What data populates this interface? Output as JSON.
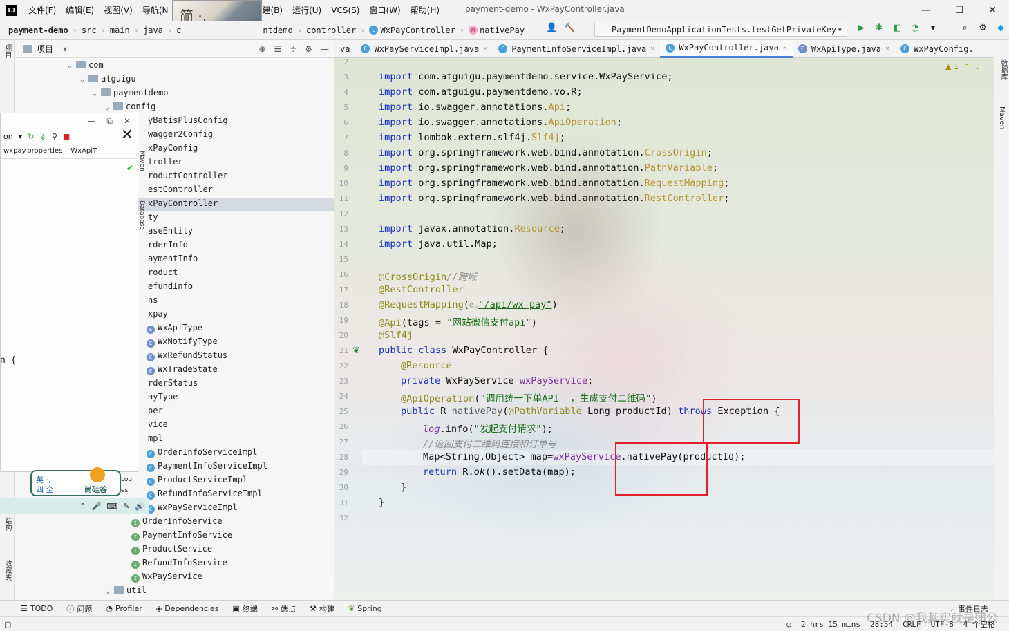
{
  "window": {
    "logo": "IJ",
    "title": "payment-demo - WxPayController.java",
    "menu": [
      "文件(F)",
      "编辑(E)",
      "视图(V)",
      "导航(N",
      "构建(B)",
      "运行(U)",
      "VCS(S)",
      "窗口(W)",
      "帮助(H)"
    ],
    "controls": [
      "—",
      "☐",
      "✕"
    ],
    "sticker_text": "简 ·,"
  },
  "navbar": {
    "breadcrumbs": [
      "payment-demo",
      "src",
      "main",
      "java",
      "c",
      "ntdemo",
      "controller",
      "WxPayController",
      "nativePay"
    ],
    "run_config": "PaymentDemoApplicationTests.testGetPrivateKey"
  },
  "project": {
    "title": "项目",
    "tree": [
      {
        "label": "com",
        "type": "folder",
        "indent": 1
      },
      {
        "label": "atguigu",
        "type": "folder",
        "indent": 2
      },
      {
        "label": "paymentdemo",
        "type": "folder",
        "indent": 3
      },
      {
        "label": "config",
        "type": "folder",
        "indent": 4
      },
      {
        "label": "yBatisPlusConfig",
        "type": "text"
      },
      {
        "label": "wagger2Config",
        "type": "text"
      },
      {
        "label": "xPayConfig",
        "type": "text"
      },
      {
        "label": "troller",
        "type": "text"
      },
      {
        "label": "roductController",
        "type": "text"
      },
      {
        "label": "estController",
        "type": "text"
      },
      {
        "label": "xPayController",
        "type": "text"
      },
      {
        "label": "ty",
        "type": "text"
      },
      {
        "label": "aseEntity",
        "type": "text"
      },
      {
        "label": "rderInfo",
        "type": "text"
      },
      {
        "label": "aymentInfo",
        "type": "text"
      },
      {
        "label": "roduct",
        "type": "text"
      },
      {
        "label": "efundInfo",
        "type": "text"
      },
      {
        "label": "ns",
        "type": "text"
      },
      {
        "label": "xpay",
        "type": "text"
      },
      {
        "label": "WxApiType",
        "type": "enum"
      },
      {
        "label": "WxNotifyType",
        "type": "enum"
      },
      {
        "label": "WxRefundStatus",
        "type": "enum"
      },
      {
        "label": "WxTradeState",
        "type": "enum"
      },
      {
        "label": "rderStatus",
        "type": "text"
      },
      {
        "label": "ayType",
        "type": "text"
      },
      {
        "label": "per",
        "type": "text"
      },
      {
        "label": "vice",
        "type": "text"
      },
      {
        "label": "mpl",
        "type": "text"
      },
      {
        "label": "OrderInfoServiceImpl",
        "type": "class"
      },
      {
        "label": "PaymentInfoServiceImpl",
        "type": "class"
      },
      {
        "label": "ProductServiceImpl",
        "type": "class"
      },
      {
        "label": "RefundInfoServiceImpl",
        "type": "class"
      },
      {
        "label": "WxPayServiceImpl",
        "type": "class"
      },
      {
        "label": "OrderInfoService",
        "type": "iface"
      },
      {
        "label": "PaymentInfoService",
        "type": "iface"
      },
      {
        "label": "ProductService",
        "type": "iface"
      },
      {
        "label": "RefundInfoService",
        "type": "iface"
      },
      {
        "label": "WxPayService",
        "type": "iface"
      },
      {
        "label": "util",
        "type": "folder",
        "indent": 1
      }
    ]
  },
  "float_panel": {
    "tabs": [
      "wxpay.properties",
      "WxApiT"
    ],
    "fragment": "n {",
    "tool_label": "on",
    "side_labels": [
      "Maven",
      "Database"
    ]
  },
  "ime": {
    "line1": "英 ·, ",
    "line2": "四 全",
    "brand": "尚硅谷",
    "extra": [
      "Log",
      "es"
    ]
  },
  "left_strip": [
    "项目",
    "结构",
    "收藏夹"
  ],
  "right_strip": [
    "数据库",
    "Maven"
  ],
  "editor": {
    "tabs": [
      {
        "label": "va",
        "icon": "",
        "active": false
      },
      {
        "label": "WxPayServiceImpl.java",
        "icon": "C",
        "active": false
      },
      {
        "label": "PaymentInfoServiceImpl.java",
        "icon": "C",
        "active": false
      },
      {
        "label": "WxPayController.java",
        "icon": "C",
        "active": true
      },
      {
        "label": "WxApiType.java",
        "icon": "E",
        "active": false
      },
      {
        "label": "WxPayConfig.",
        "icon": "C",
        "active": false
      }
    ],
    "warnings": "1",
    "line_numbers": [
      "2",
      "3",
      "4",
      "5",
      "6",
      "7",
      "8",
      "9",
      "10",
      "11",
      "12",
      "13",
      "14",
      "15",
      "16",
      "17",
      "18",
      "19",
      "20",
      "21",
      "22",
      "23",
      "24",
      "25",
      "26",
      "27",
      "28",
      "29",
      "30",
      "31",
      "32"
    ],
    "lines": {
      "l3": [
        "import",
        " com.atguigu.paymentdemo.service.WxPayService;"
      ],
      "l4": [
        "import",
        " com.atguigu.paymentdemo.vo.R;"
      ],
      "l5": [
        "import",
        " io.swagger.annotations.",
        "Api",
        ";"
      ],
      "l6": [
        "import",
        " io.swagger.annotations.",
        "ApiOperation",
        ";"
      ],
      "l7": [
        "import",
        " lombok.extern.slf4j.",
        "Slf4j",
        ";"
      ],
      "l8": [
        "import",
        " org.springframework.web.bind.annotation.",
        "CrossOrigin",
        ";"
      ],
      "l9": [
        "import",
        " org.springframework.web.bind.annotation.",
        "PathVariable",
        ";"
      ],
      "l10": [
        "import",
        " org.springframework.web.bind.annotation.",
        "RequestMapping",
        ";"
      ],
      "l11": [
        "import",
        " org.springframework.web.bind.annotation.",
        "RestController",
        ";"
      ],
      "l13": [
        "import",
        " javax.annotation.",
        "Resource",
        ";"
      ],
      "l14": [
        "import",
        " java.util.Map;"
      ],
      "l16": [
        "@CrossOrigin",
        "//跨域"
      ],
      "l17": [
        "@RestController"
      ],
      "l18": [
        "@RequestMapping",
        "(",
        "⊘⌄",
        "\"/api/wx-pay\"",
        ")"
      ],
      "l19": [
        "@Api",
        "(tags = ",
        "\"网站微信支付api\"",
        ")"
      ],
      "l20": [
        "@Slf4j"
      ],
      "l21": [
        "public class",
        " WxPayController {"
      ],
      "l22": [
        "@Resource"
      ],
      "l23": [
        "private",
        " WxPayService ",
        "wxPayService",
        ";"
      ],
      "l24": [
        "@ApiOperation",
        "(",
        "\"调用统一下单API  ，生成支付二维码\"",
        ")"
      ],
      "l25": [
        "public",
        " R ",
        "nativePay",
        "(",
        "@PathVariable",
        " Long productId) ",
        "throws",
        " Exception {"
      ],
      "l26": [
        "log",
        ".info(",
        "\"发起支付请求\"",
        ");"
      ],
      "l27": [
        "//返回支付二维码连接和订单号"
      ],
      "l28": [
        "Map<String,Object> map=",
        "wxPayService",
        ".nativePay(productId);"
      ],
      "l29": [
        "return",
        " R.",
        "ok",
        "().setData(map);"
      ],
      "l30": [
        "}"
      ],
      "l31": [
        "}"
      ]
    }
  },
  "bottom_bar": [
    "TODO",
    "问题",
    "Profiler",
    "Dependencies",
    "终端",
    "端点",
    "构建",
    "Spring",
    "事件日志"
  ],
  "status_bar": {
    "time": "2 hrs 15 mins",
    "position": "28:54",
    "line_sep": "CRLF",
    "encoding": "UTF-8",
    "indent": "4 个空格"
  },
  "watermark": "CSDN @我其实就是蒲公"
}
